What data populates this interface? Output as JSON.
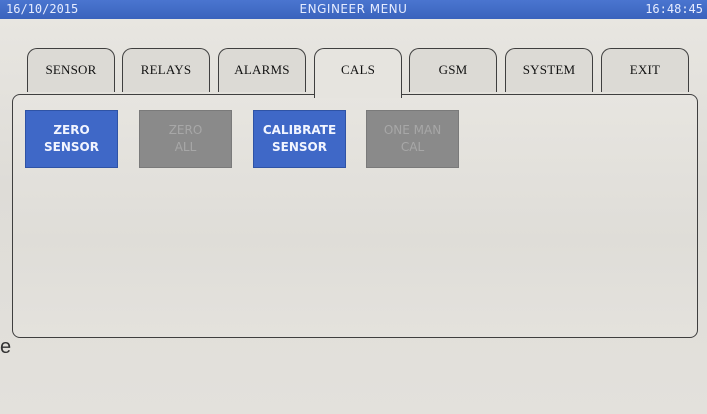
{
  "window": {
    "date": "16/10/2015",
    "title": "ENGINEER MENU",
    "time": "16:48:45"
  },
  "tabs": [
    {
      "label": "SENSOR",
      "active": false
    },
    {
      "label": "RELAYS",
      "active": false
    },
    {
      "label": "ALARMS",
      "active": false
    },
    {
      "label": "CALS",
      "active": true
    },
    {
      "label": "GSM",
      "active": false
    },
    {
      "label": "SYSTEM",
      "active": false
    },
    {
      "label": "EXIT",
      "active": false
    }
  ],
  "buttons": {
    "zero_sensor": {
      "label": "ZERO\nSENSOR",
      "enabled": true
    },
    "zero_all": {
      "label": "ZERO\nALL",
      "enabled": false
    },
    "calibrate_sensor": {
      "label": "CALIBRATE\nSENSOR",
      "enabled": true
    },
    "one_man_cal": {
      "label": "ONE MAN\nCAL",
      "enabled": false
    }
  },
  "stray_text": "e",
  "colors": {
    "titlebar": "#3a63bd",
    "button_enabled": "#3f68c7",
    "button_disabled": "#8a8a8a"
  }
}
